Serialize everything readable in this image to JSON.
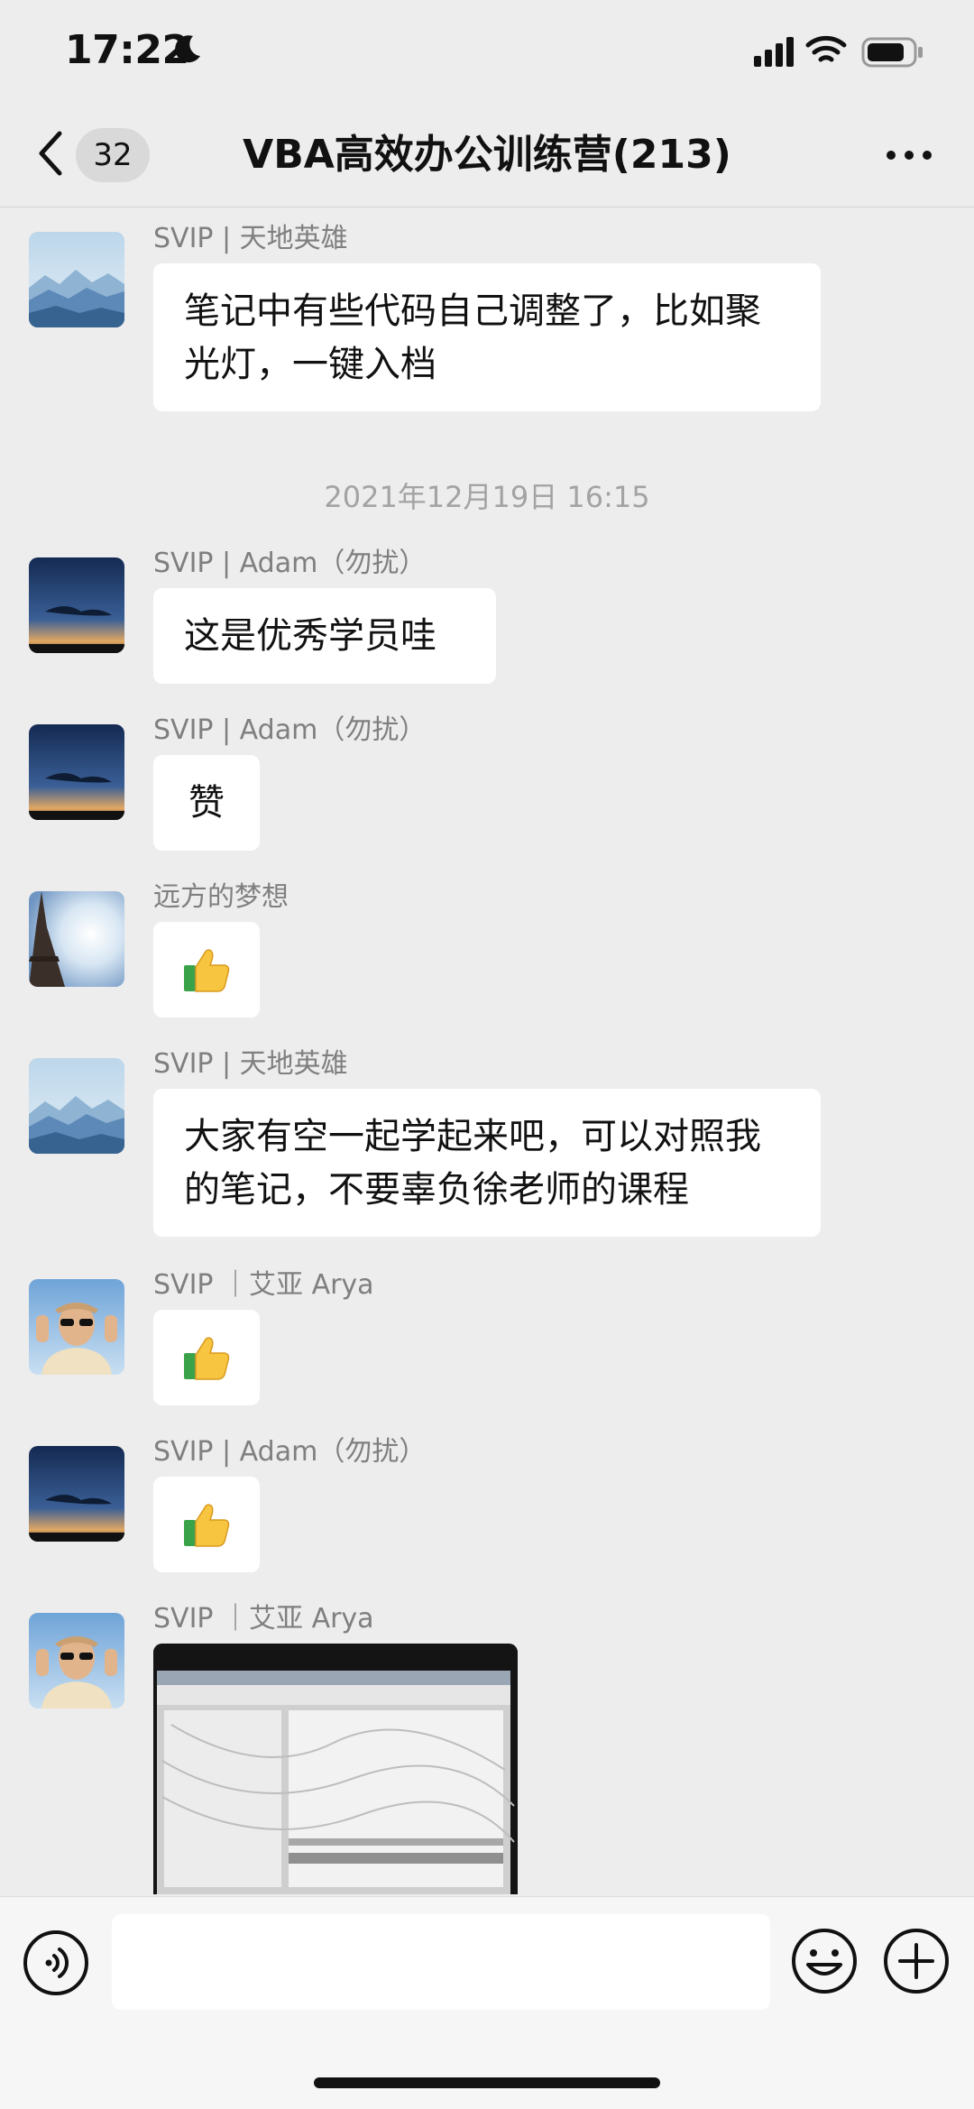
{
  "status_bar": {
    "time": "17:22",
    "icons": [
      "moon-icon",
      "signal-icon",
      "wifi-icon",
      "battery-icon"
    ]
  },
  "nav": {
    "unread_count": "32",
    "title": "VBA高效办公训练营(213)",
    "icons": [
      "back-icon",
      "more-icon"
    ]
  },
  "timestamp": "2021年12月19日 16:15",
  "messages": [
    {
      "sender": "SVIP | 天地英雄",
      "text": "笔记中有些代码自己调整了，比如聚光灯，一键入档",
      "avatar": "mountain"
    },
    {
      "sender": "SVIP | Adam（勿扰）",
      "text": "这是优秀学员哇",
      "avatar": "sunset"
    },
    {
      "sender": "SVIP | Adam（勿扰）",
      "text": "赞",
      "avatar": "sunset"
    },
    {
      "sender": "远方的梦想",
      "emoji": "thumbs-up",
      "avatar": "tower"
    },
    {
      "sender": "SVIP | 天地英雄",
      "text": "大家有空一起学起来吧，可以对照我的笔记，不要辜负徐老师的课程",
      "avatar": "mountain"
    },
    {
      "sender": "SVIP ｜艾亚 Arya",
      "emoji": "thumbs-up",
      "avatar": "person"
    },
    {
      "sender": "SVIP | Adam（勿扰）",
      "emoji": "thumbs-up",
      "avatar": "sunset"
    },
    {
      "sender": "SVIP ｜艾亚 Arya",
      "image": "photo-of-vba-editor-screen",
      "avatar": "person"
    }
  ],
  "input_bar": {
    "icons": [
      "voice-icon",
      "emoji-icon",
      "plus-icon"
    ],
    "value": ""
  },
  "colors": {
    "background": "#ededed",
    "bubble": "#ffffff",
    "meta_text": "#7f7f7f"
  }
}
